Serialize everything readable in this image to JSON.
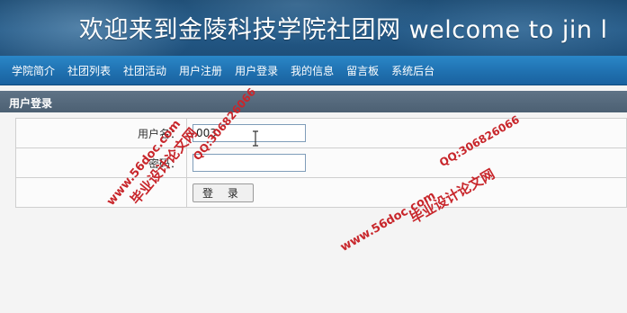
{
  "banner": {
    "title": "欢迎来到金陵科技学院社团网  welcome to jin l"
  },
  "nav": {
    "items": [
      "学院简介",
      "社团列表",
      "社团活动",
      "用户注册",
      "用户登录",
      "我的信息",
      "留言板",
      "系统后台"
    ]
  },
  "section": {
    "title": "用户登录"
  },
  "form": {
    "username_label": "用户名：",
    "username_value": "003",
    "password_label": "密码：",
    "password_value": "",
    "login_button": "登 录"
  },
  "watermarks": {
    "cn_text": "毕业设计论文网",
    "url_text": "www.56doc.com",
    "qq_text": "QQ:306826066"
  }
}
